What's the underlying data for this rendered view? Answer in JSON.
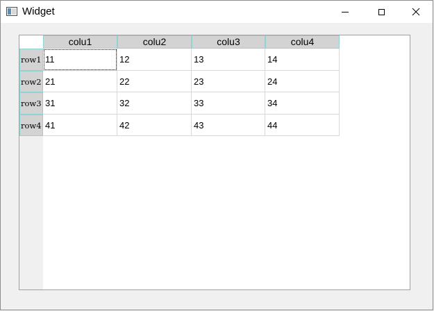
{
  "window": {
    "title": "Widget"
  },
  "table": {
    "columns": [
      "colu1",
      "colu2",
      "colu3",
      "colu4"
    ],
    "rows": [
      {
        "header": "row1",
        "cells": [
          "11",
          "12",
          "13",
          "14"
        ]
      },
      {
        "header": "row2",
        "cells": [
          "21",
          "22",
          "23",
          "24"
        ]
      },
      {
        "header": "row3",
        "cells": [
          "31",
          "32",
          "33",
          "34"
        ]
      },
      {
        "header": "row4",
        "cells": [
          "41",
          "42",
          "43",
          "44"
        ]
      }
    ]
  }
}
